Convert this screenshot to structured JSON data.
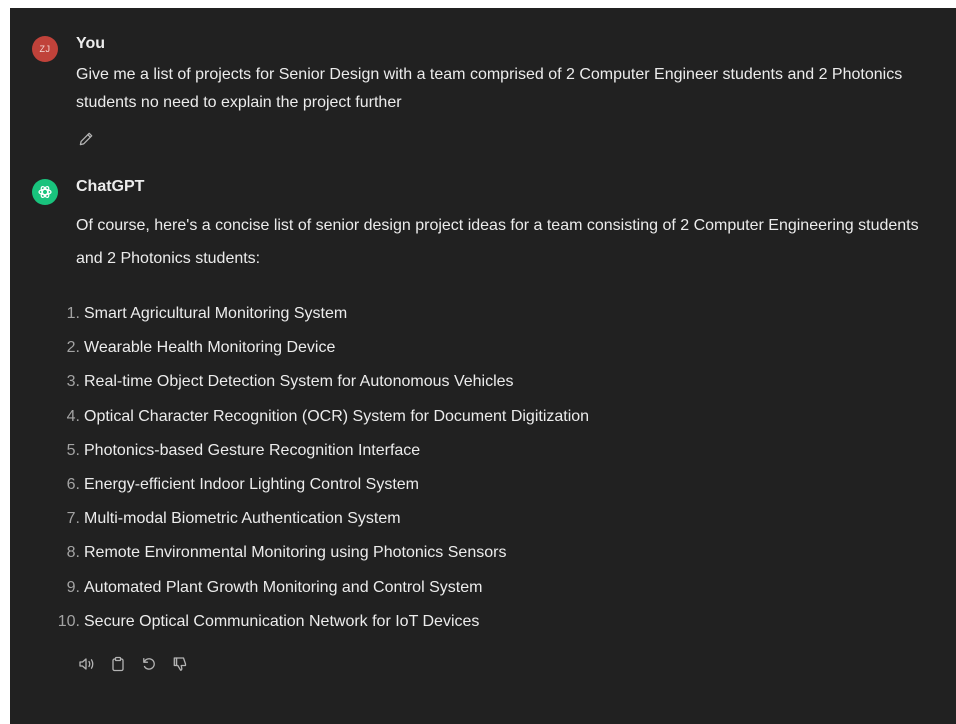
{
  "user_message": {
    "avatar_initials": "ZJ",
    "author": "You",
    "text": "Give me a list of projects for Senior Design with a team comprised of 2 Computer Engineer students and 2 Photonics students no need to explain the project further"
  },
  "assistant_message": {
    "author": "ChatGPT",
    "intro": "Of course, here's a concise list of senior design project ideas for a team consisting of 2 Computer Engineering students and 2 Photonics students:",
    "items": [
      {
        "num": "1.",
        "label": "Smart Agricultural Monitoring System"
      },
      {
        "num": "2.",
        "label": "Wearable Health Monitoring Device"
      },
      {
        "num": "3.",
        "label": "Real-time Object Detection System for Autonomous Vehicles"
      },
      {
        "num": "4.",
        "label": "Optical Character Recognition (OCR) System for Document Digitization"
      },
      {
        "num": "5.",
        "label": "Photonics-based Gesture Recognition Interface"
      },
      {
        "num": "6.",
        "label": "Energy-efficient Indoor Lighting Control System"
      },
      {
        "num": "7.",
        "label": "Multi-modal Biometric Authentication System"
      },
      {
        "num": "8.",
        "label": "Remote Environmental Monitoring using Photonics Sensors"
      },
      {
        "num": "9.",
        "label": "Automated Plant Growth Monitoring and Control System"
      },
      {
        "num": "10.",
        "label": "Secure Optical Communication Network for IoT Devices"
      }
    ]
  },
  "icons": {
    "edit": "pencil-icon",
    "read_aloud": "speaker-icon",
    "copy": "clipboard-icon",
    "regenerate": "refresh-icon",
    "dislike": "thumbs-down-icon",
    "bot_avatar": "openai-logo-icon"
  },
  "colors": {
    "background": "#212121",
    "text": "#ececec",
    "muted": "#a3a3a3",
    "user_avatar": "#c0423a",
    "bot_avatar": "#19c37d"
  }
}
